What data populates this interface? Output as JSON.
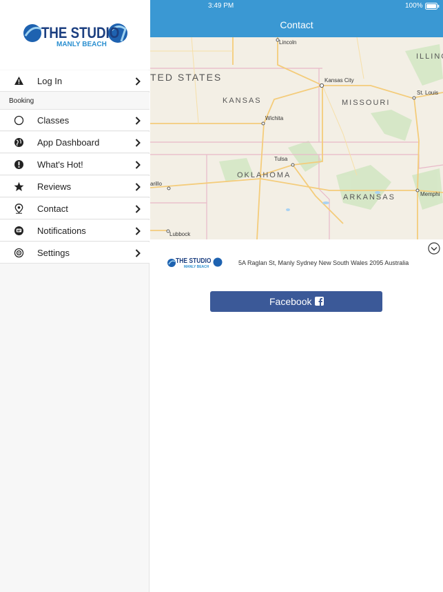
{
  "status_bar": {
    "time": "3:49 PM",
    "battery": "100%"
  },
  "nav": {
    "title": "Contact"
  },
  "brand": {
    "name": "THE STUDIO",
    "sub": "MANLY BEACH"
  },
  "sidebar": {
    "login": "Log In",
    "section": "Booking",
    "items": [
      {
        "label": "Classes",
        "icon": "circle-outline-icon"
      },
      {
        "label": "App Dashboard",
        "icon": "globe-icon"
      },
      {
        "label": "What's Hot!",
        "icon": "alert-circle-icon"
      },
      {
        "label": "Reviews",
        "icon": "star-icon"
      },
      {
        "label": "Contact",
        "icon": "map-pin-icon"
      },
      {
        "label": "Notifications",
        "icon": "chat-icon"
      },
      {
        "label": "Settings",
        "icon": "gear-icon"
      }
    ]
  },
  "map": {
    "states": [
      "TED STATES",
      "KANSAS",
      "MISSOURI",
      "OKLAHOMA",
      "ARKANSAS",
      "ILLING"
    ],
    "cities": [
      "Lincoln",
      "Kansas City",
      "St. Louis",
      "Wichita",
      "Tulsa",
      "arillo",
      "Memphi",
      "Lubbock"
    ]
  },
  "contact": {
    "address": "5A Raglan St, Manly Sydney New South Wales 2095 Australia",
    "facebook_label": "Facebook"
  },
  "colors": {
    "primary": "#3a98d3",
    "facebook": "#3b5998"
  }
}
